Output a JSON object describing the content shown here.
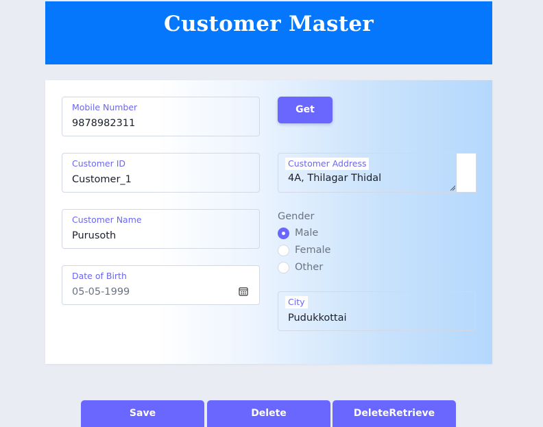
{
  "header": {
    "title": "Customer Master"
  },
  "form": {
    "mobile": {
      "label": "Mobile Number",
      "value": "9878982311"
    },
    "get_button": "Get",
    "customer_id": {
      "label": "Customer ID",
      "value": "Customer_1"
    },
    "address": {
      "label": "Customer Address",
      "value": "4A, Thilagar Thidal"
    },
    "name": {
      "label": "Customer Name",
      "value": "Purusoth"
    },
    "gender": {
      "label": "Gender",
      "options": [
        "Male",
        "Female",
        "Other"
      ],
      "selected": "Male"
    },
    "dob": {
      "label": "Date of Birth",
      "value": "05-05-1999"
    },
    "city": {
      "label": "City",
      "value": "Pudukkottai"
    }
  },
  "actions": {
    "save": "Save",
    "delete": "Delete",
    "delete_retrieve": "DeleteRetrieve"
  },
  "colors": {
    "header": "#0477fd",
    "accent": "#6a67ff",
    "label": "#6b66ee"
  }
}
